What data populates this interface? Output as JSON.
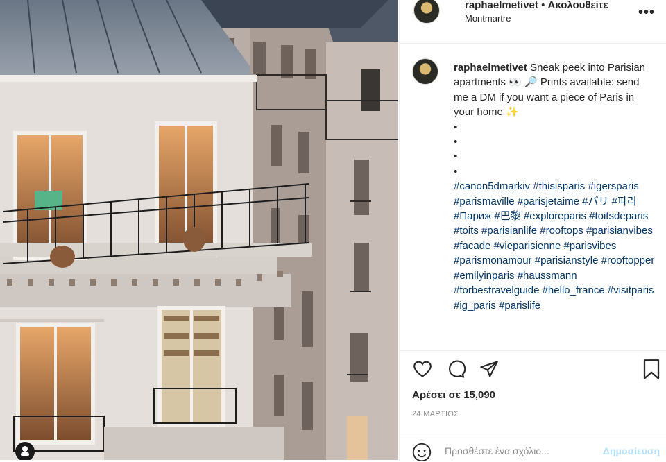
{
  "post": {
    "username": "raphaelmetivet",
    "separator": "•",
    "follow_state": "Ακολουθείτε",
    "location": "Montmartre",
    "more_label": "•••"
  },
  "caption": {
    "username": "raphaelmetivet",
    "text_lines": [
      "Sneak peek into",
      "Parisian apartments 👀 🔎 Prints",
      "available: send me a DM if you want a",
      "piece of Paris in your home ✨"
    ],
    "bullets": [
      "•",
      "•",
      "•",
      "•"
    ],
    "hashtags": [
      "#canon5dmarkiv",
      "#thisisparis",
      "#igersparis",
      "#parismaville",
      "#parisjetaime",
      "#パリ",
      "#파리",
      "#Париж",
      "#巴黎",
      "#exploreparis",
      "#toitsdeparis",
      "#toits",
      "#parisianlife",
      "#rooftops",
      "#parisianvibes",
      "#facade",
      "#vieparisienne",
      "#parisvibes",
      "#parismonamour",
      "#parisianstyle",
      "#rooftopper",
      "#emilyinparis",
      "#haussmann",
      "#forbestravelguide",
      "#hello_france",
      "#visitparis",
      "#ig_paris",
      "#parislife"
    ]
  },
  "stats": {
    "likes": "Αρέσει σε 15,090",
    "date": "24 ΜΑΡΤΙΟΣ"
  },
  "comment": {
    "placeholder": "Προσθέστε ένα σχόλιο...",
    "post_label": "Δημοσίευση"
  },
  "icons": [
    "heart-icon",
    "comment-icon",
    "share-icon",
    "bookmark-icon",
    "emoji-icon",
    "more-icon"
  ],
  "colors": {
    "hashtag": "#00376b",
    "post_disabled": "#b2dffc",
    "muted": "#8e8e8e"
  }
}
